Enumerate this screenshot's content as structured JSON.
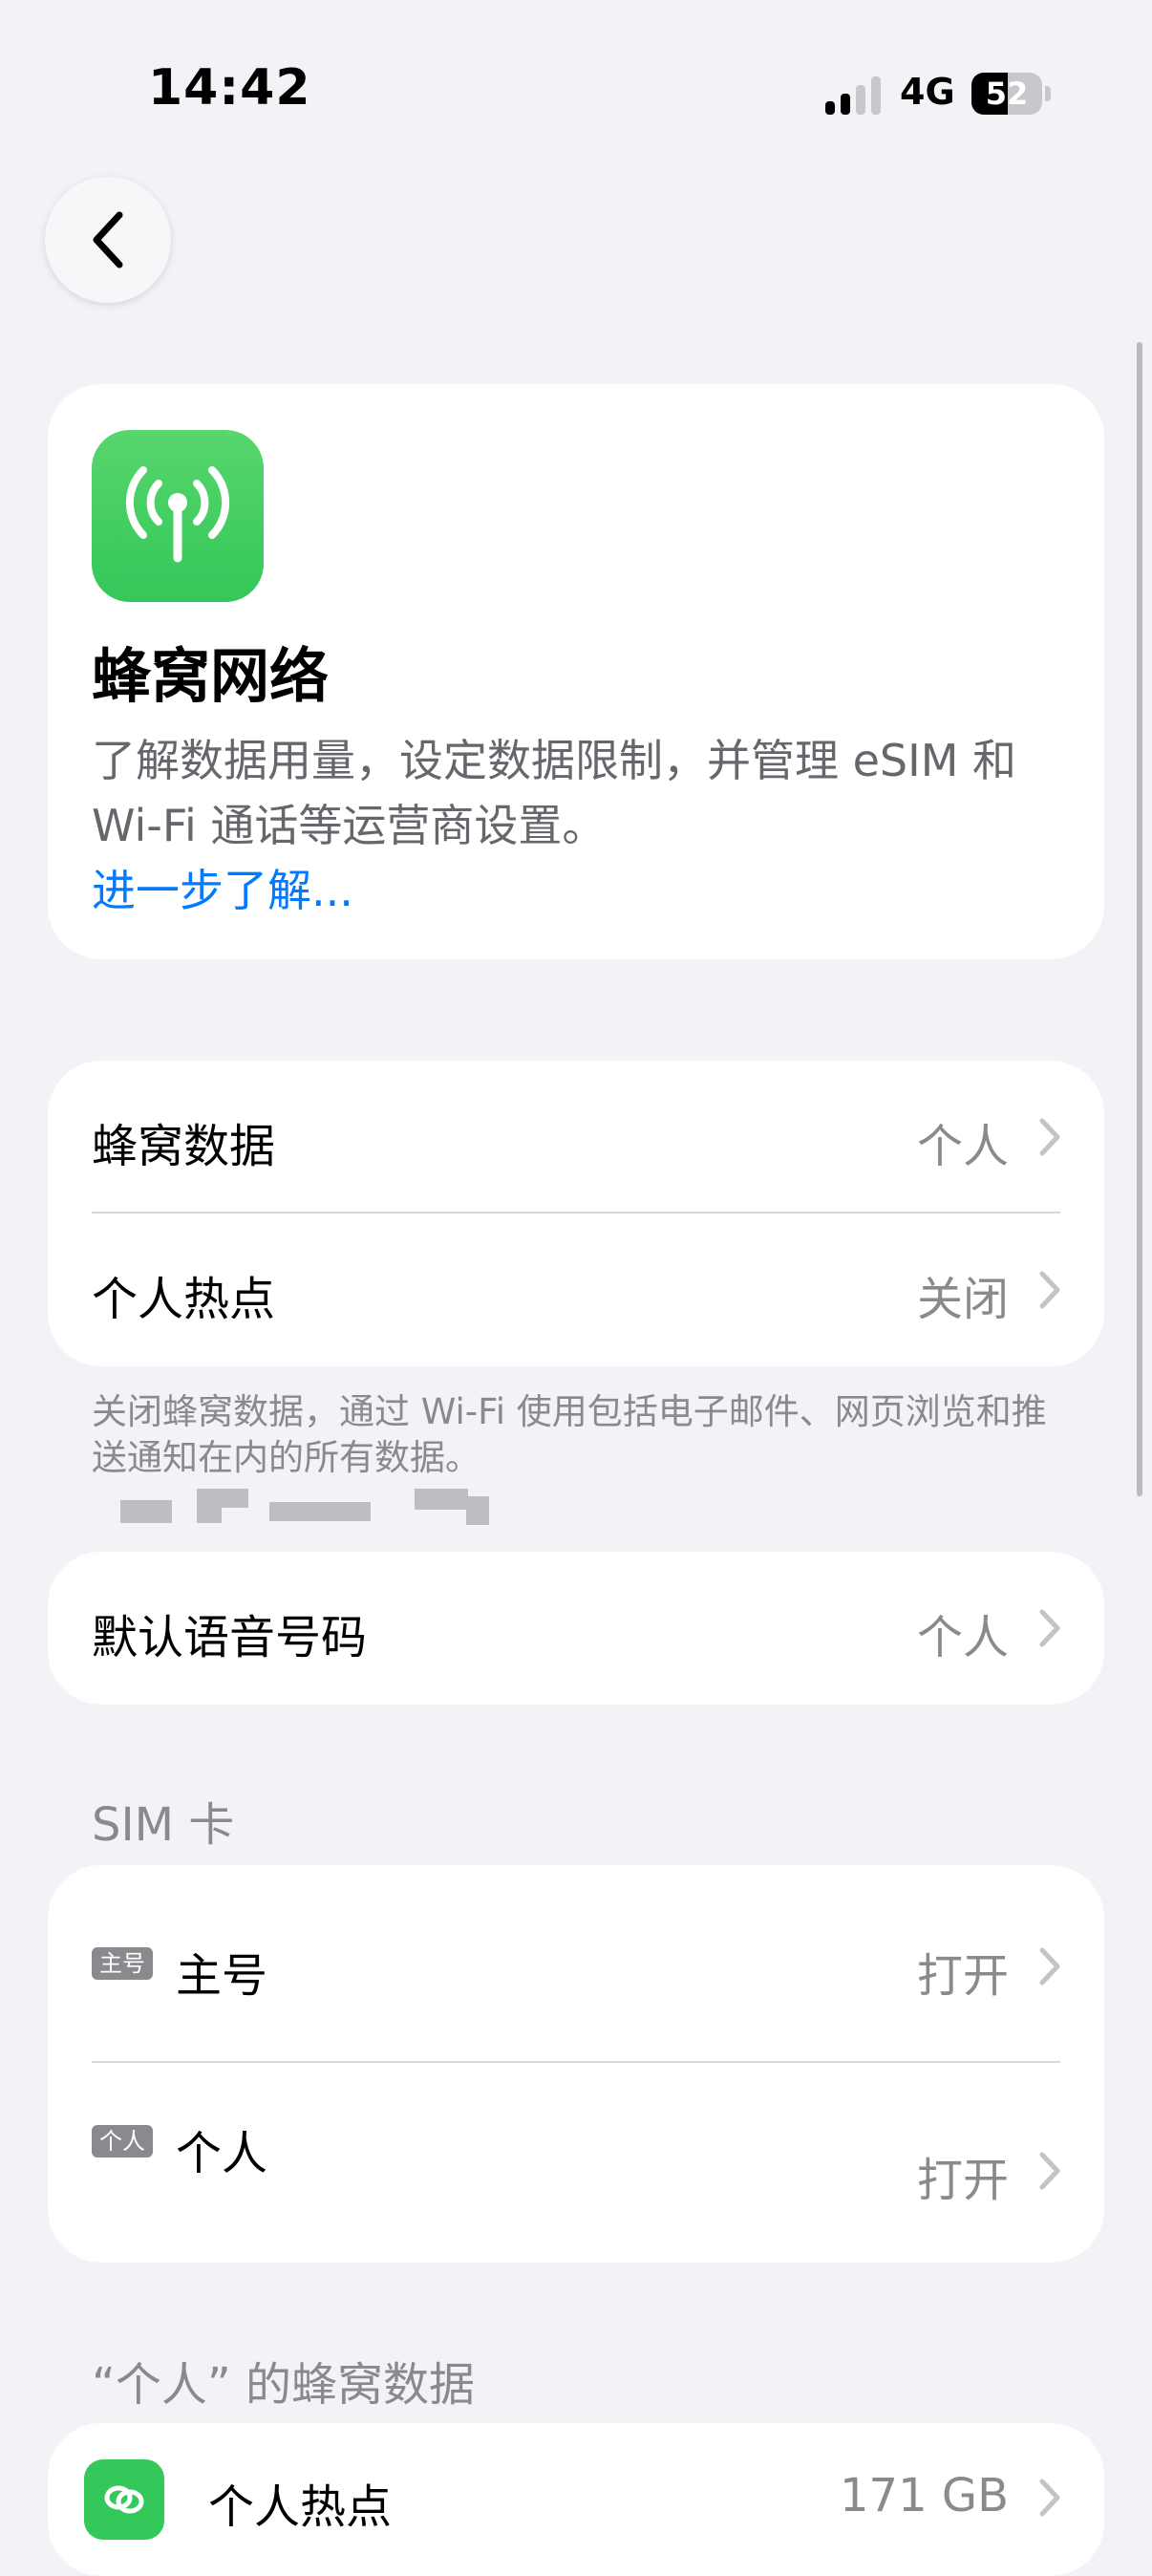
{
  "status_bar": {
    "time": "14:42",
    "network": "4G",
    "battery_percent": "52",
    "battery_level": 0.52
  },
  "icons": {
    "back": "chevron-left-icon",
    "app": "antenna-icon",
    "chevron": "chevron-right-icon",
    "hotspot": "link-icon"
  },
  "colors": {
    "accent": "#007aff",
    "app_icon": "#34c759",
    "background": "#f2f2f7"
  },
  "hero": {
    "title": "蜂窝网络",
    "description": "了解数据用量，设定数据限制，并管理 eSIM 和 Wi‑Fi 通话等运营商设置。",
    "learn_more": "进一步了解..."
  },
  "cellular_group": {
    "rows": [
      {
        "label": "蜂窝数据",
        "value": "个人"
      },
      {
        "label": "个人热点",
        "value": "关闭"
      }
    ],
    "footnote": "关闭蜂窝数据，通过 Wi‑Fi 使用包括电子邮件、网页浏览和推送通知在内的所有数据。"
  },
  "voice_group": {
    "label": "默认语音号码",
    "value": "个人"
  },
  "sim_section": {
    "header": "SIM 卡",
    "items": [
      {
        "tag": "主号",
        "label": "主号",
        "value": "打开"
      },
      {
        "tag": "个人",
        "label": "个人",
        "value": "打开"
      }
    ]
  },
  "usage_section": {
    "header": "“个人” 的蜂窝数据",
    "items": [
      {
        "label": "个人热点",
        "value": "171 GB"
      }
    ]
  }
}
